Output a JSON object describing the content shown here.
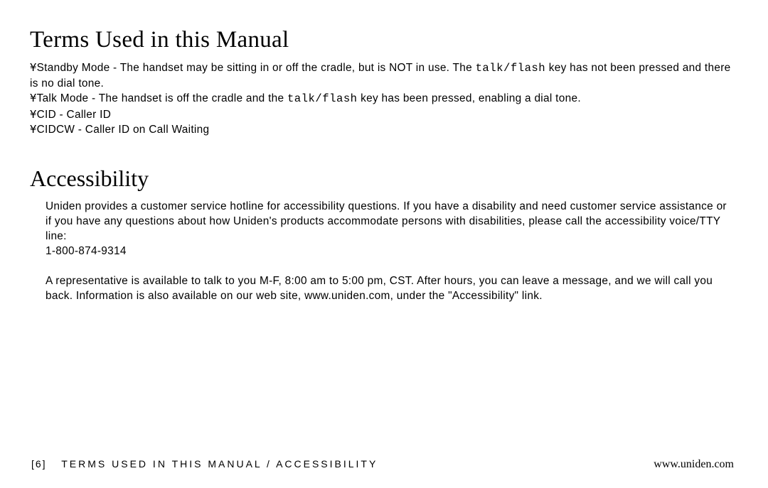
{
  "sections": {
    "terms": {
      "heading": "Terms Used in this Manual",
      "bullet_char": "¥",
      "items": [
        {
          "pre": "Standby Mode - The handset may be sitting in or off the cradle, but is NOT in use. The ",
          "key": "talk/flash",
          "post": " key has not been pressed and there is no dial tone."
        },
        {
          "pre": "Talk Mode - The handset is off the cradle and the ",
          "key": "talk/flash",
          "post": " key has been pressed, enabling a dial tone."
        },
        {
          "pre": "CID - Caller ID",
          "key": "",
          "post": ""
        },
        {
          "pre": "CIDCW - Caller ID on Call Waiting",
          "key": "",
          "post": ""
        }
      ]
    },
    "accessibility": {
      "heading": "Accessibility",
      "para1": "Uniden provides a customer service hotline for accessibility questions. If you have a disability and need customer service assistance or if you have any questions about how Uniden's  products accommodate persons with disabilities, please call the accessibility voice/TTY line:",
      "phone": "1-800-874-9314",
      "para2": "A representative is available to talk to you M-F, 8:00 am to 5:00 pm, CST. After hours, you can leave a message, and we will call you back. Information is also available on our web site, www.uniden.com, under the \"Accessibility\" link."
    }
  },
  "footer": {
    "page_num": "[6]",
    "breadcrumb": "TERMS USED IN THIS MANUAL / ACCESSIBILITY",
    "url": "www.uniden.com"
  }
}
